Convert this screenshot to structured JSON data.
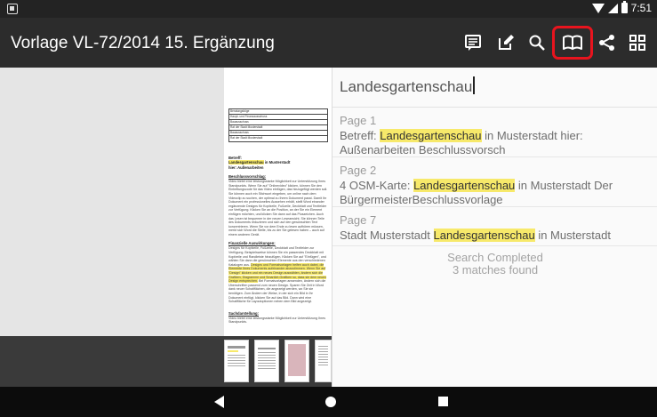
{
  "status_bar": {
    "time": "7:51"
  },
  "app_bar": {
    "title": "Vorlage VL-72/2014 15. Ergänzung",
    "actions": [
      "notes-icon",
      "edit-icon",
      "search-icon",
      "book-icon",
      "share-icon",
      "grid-icon"
    ],
    "highlighted_action": "book-icon",
    "highlight_color": "#e8141e"
  },
  "search": {
    "query": "Landesgartenschau",
    "results": [
      {
        "page": "Page 1",
        "before": "Betreff: ",
        "match": "Landesgartenschau",
        "after": " in Musterstadt hier: Außenarbeiten Beschlussvorsch"
      },
      {
        "page": "Page 2",
        "before": "4 OSM-Karte: ",
        "match": "Landesgartenschau",
        "after": " in Musterstadt Der BürgermeisterBeschlussvorlage"
      },
      {
        "page": "Page 7",
        "before": "Stadt Musterstadt ",
        "match": "Landesgartenschau",
        "after": " in Musterstadt"
      }
    ],
    "status_title": "Search Completed",
    "status_count": "3 matches found",
    "highlight_color": "#f7e96a"
  },
  "document": {
    "table_rows": [
      "Beratungsfolge",
      "Haupt- und Finanzausschuss",
      "Bauausschuss",
      "Rat der Stadt Musterstadt",
      "Bauausschuss",
      "Rat der Stadt Musterstadt"
    ],
    "betreff_label": "Betreff:",
    "betreff_match": "Landesgartenschau",
    "betreff_after": " in Musterstadt",
    "betreff_line2": "hier: Außenarbeiten",
    "section_beschluss": "Beschlussvorschlag:",
    "para1": "Video bietet eine leistungsstarke Möglichkeit zur Unterstützung Ihres Standpunkts. Wenn Sie auf \"Onlinevideo\" klicken, können Sie den Einbettungscode für das Video einfügen, das hinzugefügt werden soll. Sie können auch ein Stichwort eingeben, um online nach dem Videoclip zu suchen, der optimal zu Ihrem Dokument passt. Damit Ihr Dokument ein professionelles Aussehen erhält, stellt Word einander ergänzende Designs für Kopfzeile, Fußzeile, Deckblatt und Textfelder zur Verfügung. Klicken Sie an die Position, an der Sie ein Element einfügen möchten, und klicken Sie dann auf das Pluszeichen. Auch das Lesen ist bequemer in der neuen Leseansicht. Sie können Teile des Dokuments reduzieren und sich auf den gewünschten Text konzentrieren. Wenn Sie vor dem Ende zu lesen aufhören müssen, merkt sich Word die Stelle, bis zu der Sie gelesen haben – auch auf einem anderen Gerät.",
    "section_finanz": "Finanzielle Auswirkungen:",
    "para2": "Designs für Kopfzeile, Fußzeile, Deckblatt und Textfelder zur Verfügung. Beispielsweise können Sie ein passendes Deckblatt mit Kopfzeile und Randleiste hinzufügen. Klicken Sie auf \"Einfügen\", und wählen Sie dann die gewünschten Elemente aus den verschiedenen Katalogen aus.",
    "para2_highlight": "Designs und Formatvorlagen helfen auch dabei, die Elemente Ihres Dokuments aufeinander abzustimmen. Wenn Sie auf \"Design\" klicken und ein neues Design auswählen, ändern sich die Grafiken, Diagramme und SmartArt-Grafiken so, dass sie dem neuen Design entsprechen.",
    "para2_end": "Bei Formatvorlagen anwenden, ändern sich die Überschriften passend zum neuen Design. Sparen Sie Zeit in Word dank neuer Schaltflächen, die angezeigt werden, wo Sie sie benötigen. Zum Ändern der Weise, in der sich ein Bild in Ihr Dokument einfügt, klicken Sie auf das Bild. Dann wird eine Schaltfläche für Layoutoptionen neben dem Bild angezeigt.",
    "section_sach": "Sachdarstellung:",
    "para3": "Video bietet eine leistungsstarke Möglichkeit zur Unterstützung Ihres Standpunkts."
  }
}
